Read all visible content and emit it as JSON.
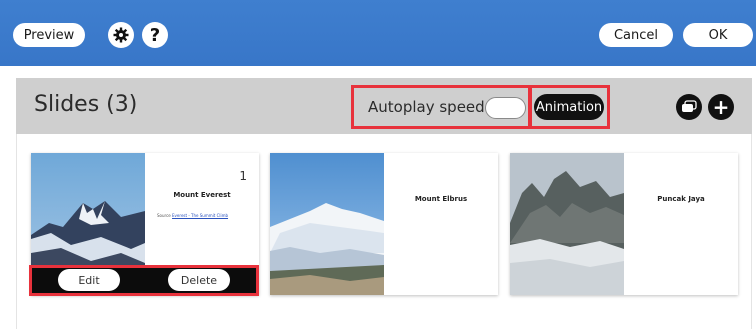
{
  "toolbar": {
    "preview_label": "Preview",
    "settings_icon": "gear-icon",
    "help_label": "?",
    "cancel_label": "Cancel",
    "ok_label": "OK"
  },
  "slides_header": {
    "title": "Slides (3)",
    "autoplay_label": "Autoplay speed",
    "autoplay_enabled": false,
    "animation_label": "Animation",
    "duplicate_icon": "duplicate-icon",
    "add_label": "+"
  },
  "slides": [
    {
      "number": "1",
      "title": "Mount Everest",
      "source_prefix": "Source",
      "source_link": "Everest - The Summit Climb",
      "image": "mount-everest-photo"
    },
    {
      "title": "Mount Elbrus",
      "image": "mount-elbrus-photo"
    },
    {
      "title": "Puncak Jaya",
      "image": "puncak-jaya-photo"
    }
  ],
  "slide_actions": {
    "edit_label": "Edit",
    "delete_label": "Delete"
  },
  "colors": {
    "topbar": "#3a79ca",
    "header": "#cfcfcf",
    "highlight": "#e8323c",
    "dark_button": "#111111"
  }
}
